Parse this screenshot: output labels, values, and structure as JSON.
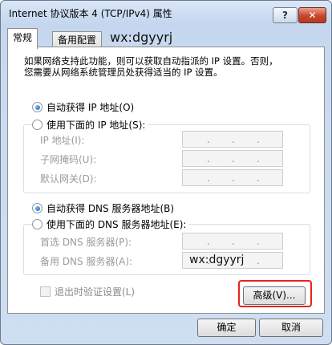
{
  "window": {
    "title": "Internet 协议版本 4 (TCP/IPv4) 属性",
    "help_label": "?",
    "close_label": "✕"
  },
  "tabs": [
    {
      "label": "常规",
      "active": true
    },
    {
      "label": "备用配置",
      "active": false
    }
  ],
  "watermark": "wx:dgyyrj",
  "info_text_line1": "如果网络支持此功能，则可以获取自动指派的 IP 设置。否则，",
  "info_text_line2": "您需要从网络系统管理员处获得适当的 IP 设置。",
  "ip_section": {
    "auto_label": "自动获得 IP 地址(O)",
    "manual_label": "使用下面的 IP 地址(S):",
    "selected": "auto",
    "fields": [
      {
        "label": "IP 地址(I):",
        "value": ""
      },
      {
        "label": "子网掩码(U):",
        "value": ""
      },
      {
        "label": "默认网关(D):",
        "value": ""
      }
    ]
  },
  "dns_section": {
    "auto_label": "自动获得 DNS 服务器地址(B)",
    "manual_label": "使用下面的 DNS 服务器地址(E):",
    "selected": "auto",
    "fields": [
      {
        "label": "首选 DNS 服务器(P):",
        "value": ""
      },
      {
        "label": "备用 DNS 服务器(A):",
        "value": ""
      }
    ]
  },
  "validate_label": "退出时验证设置(L)",
  "advanced_label": "高级(V)...",
  "ok_label": "确定",
  "cancel_label": "取消",
  "colors": {
    "highlight_border": "#e8231e",
    "radio_fill": "#1b5fb8",
    "disabled_text": "#9b9b9b"
  }
}
